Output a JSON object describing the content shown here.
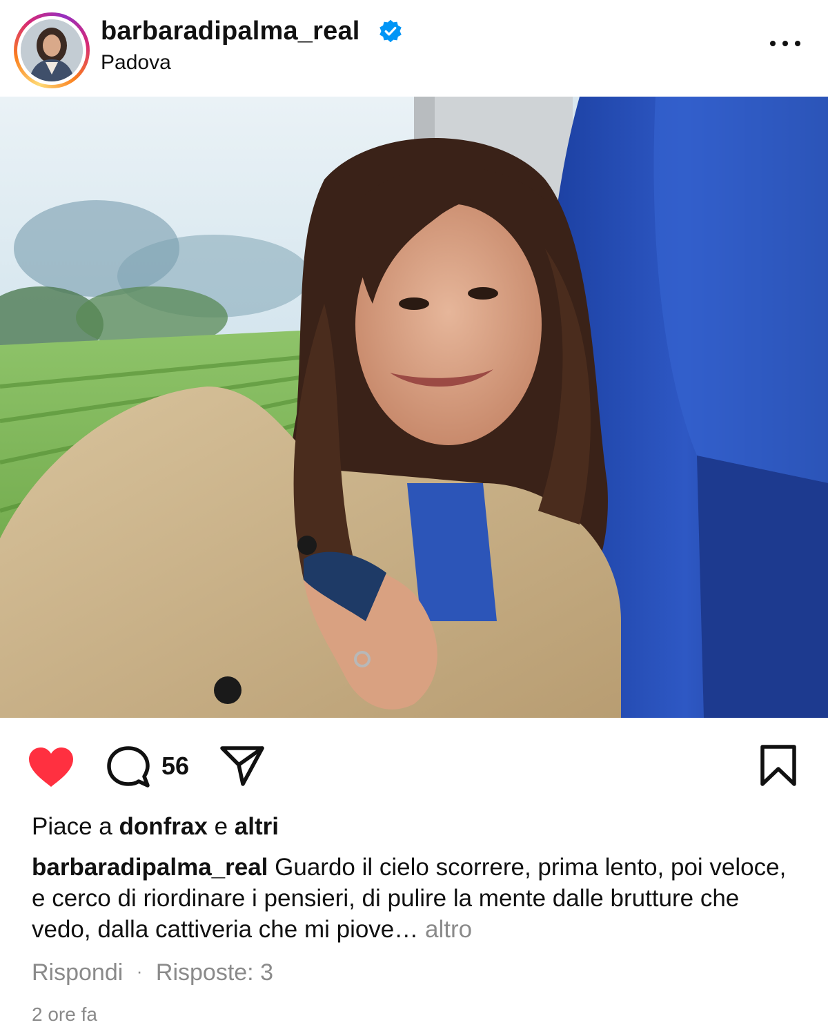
{
  "post": {
    "username": "barbaradipalma_real",
    "location": "Padova",
    "verified": true
  },
  "actions": {
    "comment_count": "56",
    "liked": true,
    "like_color": "#ff3040"
  },
  "likes": {
    "prefix": "Piace a",
    "user": "donfrax",
    "conjunction": "e",
    "others": "altri"
  },
  "caption": {
    "username": "barbaradipalma_real",
    "text": "Guardo il cielo scorrere, prima lento, poi veloce, e cerco di riordinare i pensieri, di pulire la mente dalle brutture che vedo, dalla cattiveria che mi piove…",
    "more_label": "altro"
  },
  "replies": {
    "reply_label": "Rispondi",
    "separator": "·",
    "replies_label": "Risposte: 3"
  },
  "timestamp": "2 ore fa",
  "icons": {
    "verified": "verified-badge-icon",
    "more": "more-options-icon",
    "like": "heart-icon",
    "comment": "comment-icon",
    "share": "share-icon",
    "save": "bookmark-icon"
  },
  "colors": {
    "verified_blue": "#0095f6",
    "muted_text": "#8a8a8a"
  }
}
